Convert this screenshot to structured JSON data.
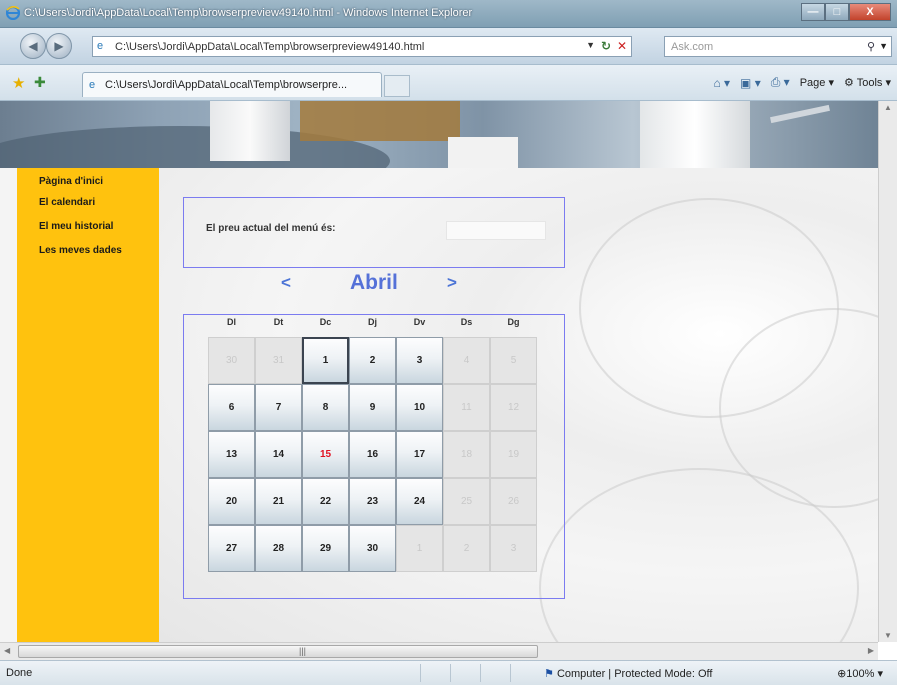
{
  "window": {
    "title": "C:\\Users\\Jordi\\AppData\\Local\\Temp\\browserpreview49140.html - Windows Internet Explorer",
    "min_glyph": "—",
    "max_glyph": "□",
    "close_glyph": "X"
  },
  "address_bar": {
    "url": "C:\\Users\\Jordi\\AppData\\Local\\Temp\\browserpreview49140.html",
    "search_placeholder": "Ask.com"
  },
  "tab": {
    "label": "C:\\Users\\Jordi\\AppData\\Local\\Temp\\browserpre..."
  },
  "toolbar": {
    "page_label": "Page",
    "tools_label": "Tools"
  },
  "sidebar": {
    "items": [
      {
        "label": "Pàgina d'inici"
      },
      {
        "label": "El calendari"
      },
      {
        "label": "El meu historial"
      },
      {
        "label": "Les meves dades"
      }
    ]
  },
  "price": {
    "label": "El preu actual del menú és:",
    "value": ""
  },
  "calendar": {
    "prev": "<",
    "next": ">",
    "month": "Abril",
    "weekdays": [
      "Dl",
      "Dt",
      "Dc",
      "Dj",
      "Dv",
      "Ds",
      "Dg"
    ],
    "days": [
      {
        "n": "30",
        "state": "out"
      },
      {
        "n": "31",
        "state": "out"
      },
      {
        "n": "1",
        "state": "sel"
      },
      {
        "n": "2",
        "state": "in"
      },
      {
        "n": "3",
        "state": "in"
      },
      {
        "n": "4",
        "state": "out"
      },
      {
        "n": "5",
        "state": "out"
      },
      {
        "n": "6",
        "state": "in"
      },
      {
        "n": "7",
        "state": "in"
      },
      {
        "n": "8",
        "state": "in"
      },
      {
        "n": "9",
        "state": "in"
      },
      {
        "n": "10",
        "state": "in"
      },
      {
        "n": "11",
        "state": "out"
      },
      {
        "n": "12",
        "state": "out"
      },
      {
        "n": "13",
        "state": "in"
      },
      {
        "n": "14",
        "state": "in"
      },
      {
        "n": "15",
        "state": "today"
      },
      {
        "n": "16",
        "state": "in"
      },
      {
        "n": "17",
        "state": "in"
      },
      {
        "n": "18",
        "state": "out"
      },
      {
        "n": "19",
        "state": "out"
      },
      {
        "n": "20",
        "state": "in"
      },
      {
        "n": "21",
        "state": "in"
      },
      {
        "n": "22",
        "state": "in"
      },
      {
        "n": "23",
        "state": "in"
      },
      {
        "n": "24",
        "state": "in"
      },
      {
        "n": "25",
        "state": "out"
      },
      {
        "n": "26",
        "state": "out"
      },
      {
        "n": "27",
        "state": "in"
      },
      {
        "n": "28",
        "state": "in"
      },
      {
        "n": "29",
        "state": "in"
      },
      {
        "n": "30",
        "state": "in"
      },
      {
        "n": "1",
        "state": "out"
      },
      {
        "n": "2",
        "state": "out"
      },
      {
        "n": "3",
        "state": "out"
      }
    ]
  },
  "status_bar": {
    "left": "Done",
    "zone": "Computer | Protected Mode: Off",
    "zoom": "100%"
  },
  "colors": {
    "sidebar": "#ffc20e",
    "month_title": "#5571d8",
    "today": "#e01020",
    "box_border": "#7b7bf0"
  }
}
